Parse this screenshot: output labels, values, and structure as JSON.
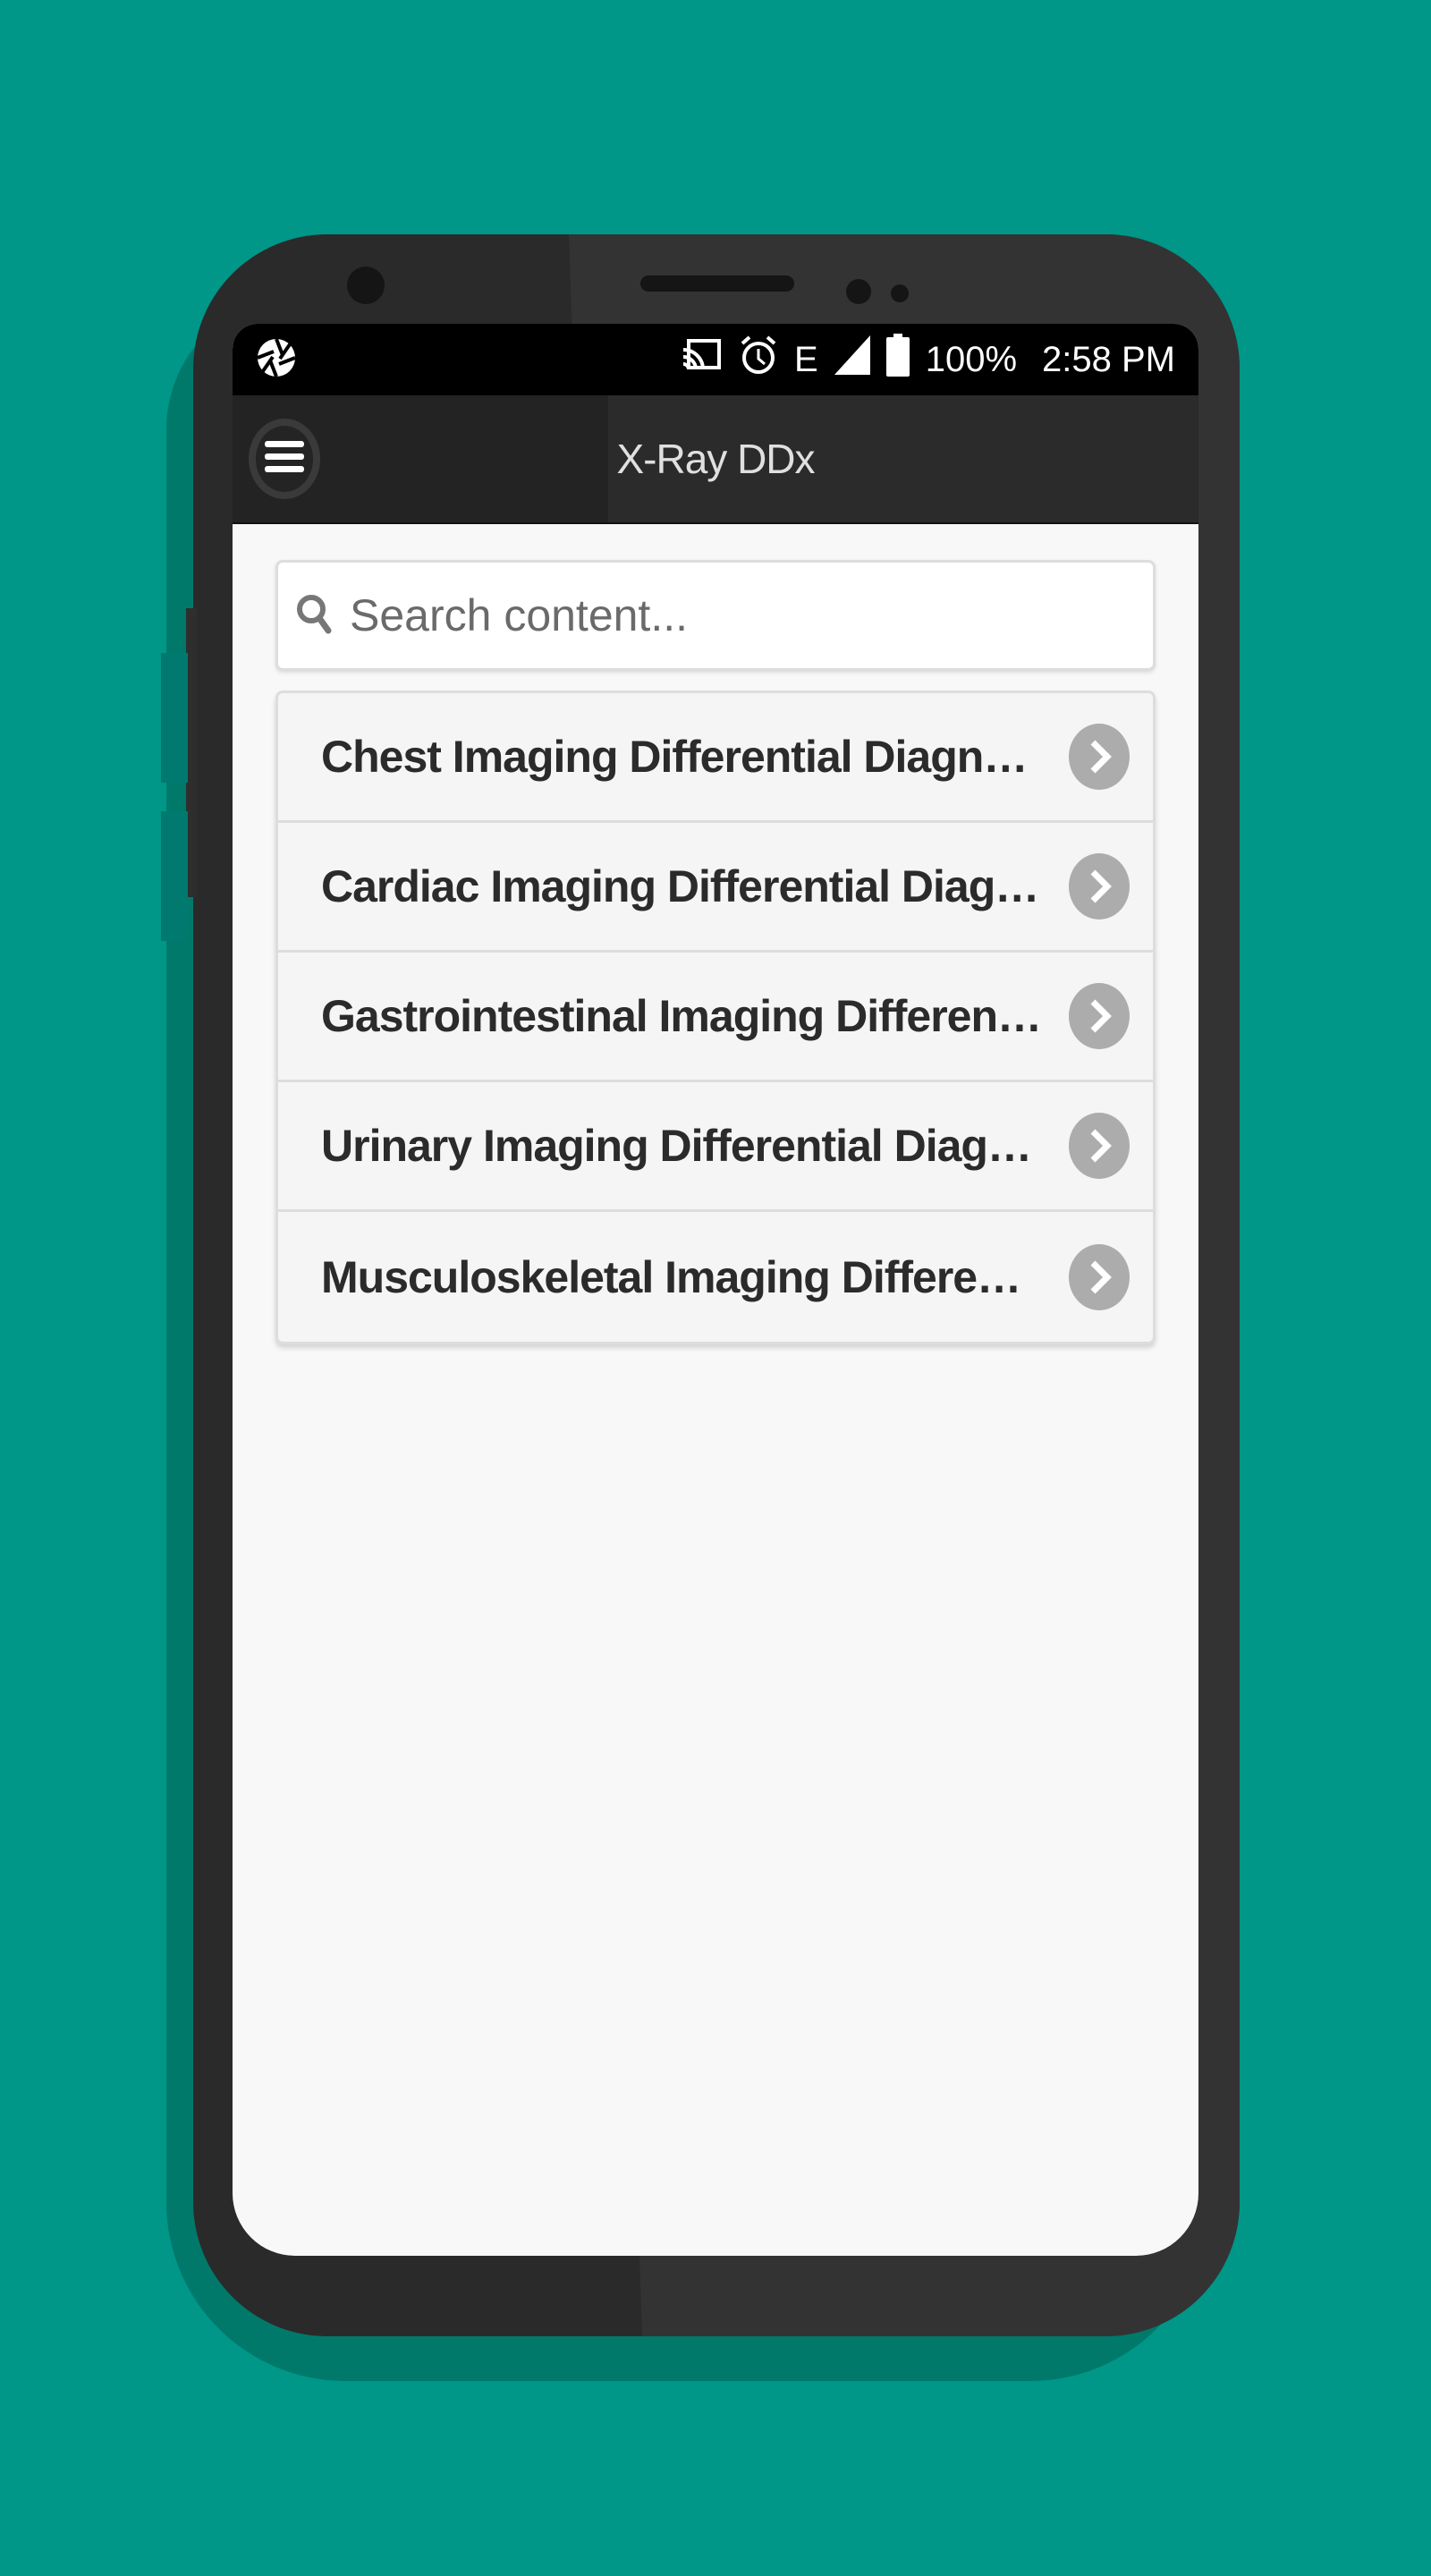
{
  "statusbar": {
    "left_icon": "shutter-icon",
    "icons": [
      "cast-icon",
      "alarm-icon",
      "edge-network-icon",
      "signal-icon",
      "battery-icon"
    ],
    "network_label": "E",
    "battery": "100%",
    "time": "2:58 PM"
  },
  "appbar": {
    "menu_icon": "hamburger-menu-icon",
    "title": "X-Ray DDx"
  },
  "search": {
    "icon": "search-icon",
    "placeholder": "Search content...",
    "value": ""
  },
  "list": {
    "items": [
      {
        "label": "Chest Imaging Differential Diagnoses",
        "icon": "chevron-right-icon"
      },
      {
        "label": "Cardiac Imaging Differential Diagno...",
        "icon": "chevron-right-icon"
      },
      {
        "label": "Gastrointestinal Imaging Differentia...",
        "icon": "chevron-right-icon"
      },
      {
        "label": "Urinary Imaging Differential Diagno...",
        "icon": "chevron-right-icon"
      },
      {
        "label": "Musculoskeletal Imaging Differenti...",
        "icon": "chevron-right-icon"
      }
    ]
  },
  "colors": {
    "background": "#009688",
    "phone_body": "#2a2a2a",
    "appbar": "#232323",
    "chevron_badge": "#acacac",
    "item_text": "#2b2b2b"
  }
}
